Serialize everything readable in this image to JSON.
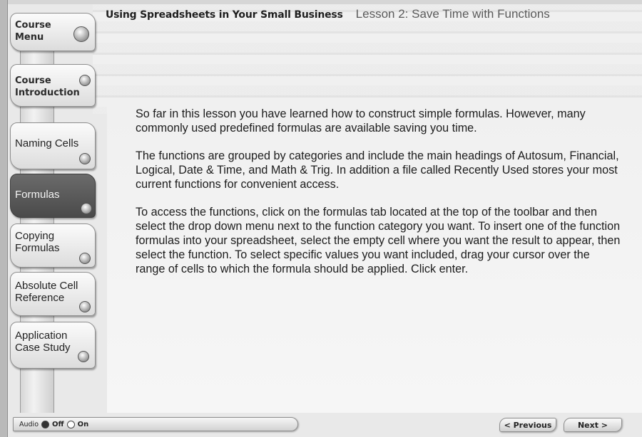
{
  "header": {
    "course_title": "Using Spreadsheets in Your Small Business",
    "lesson_title": "Lesson 2: Save Time with Functions"
  },
  "sidebar": {
    "items": [
      {
        "label_line1": "Course",
        "label_line2": "Menu"
      },
      {
        "label_line1": "Course",
        "label_line2": "Introduction"
      },
      {
        "label_line1": "Naming Cells",
        "label_line2": ""
      },
      {
        "label_line1": "Formulas",
        "label_line2": ""
      },
      {
        "label_line1": "Copying",
        "label_line2": "Formulas"
      },
      {
        "label_line1": "Absolute Cell",
        "label_line2": "Reference"
      },
      {
        "label_line1": "Application",
        "label_line2": "Case Study"
      }
    ],
    "active_item": "Formulas"
  },
  "main": {
    "paragraphs": [
      "So far in this lesson  you have learned how to construct simple formulas. However, many  commonly used  predefined formulas are available saving you time.",
      "The functions are grouped by categories and include the main headings of Autosum, Financial, Logical, Date & Time, and Math & Trig. In addition a file called Recently Used stores your most current functions for convenient access.",
      "To access the functions, click on the formulas tab located at the top of the toolbar and then select the drop down menu next to the function category you want. To insert one of the function formulas into your spreadsheet, select the empty cell  where you want the result to appear, then select the function. To select specific values you want included, drag your cursor over the range of cells to which the formula should be applied.  Click enter."
    ]
  },
  "footer": {
    "audio_label": "Audio",
    "audio_off_label": "Off",
    "audio_on_label": "On",
    "audio_selected": "Off",
    "prev_label": "< Previous",
    "next_label": "Next >"
  }
}
